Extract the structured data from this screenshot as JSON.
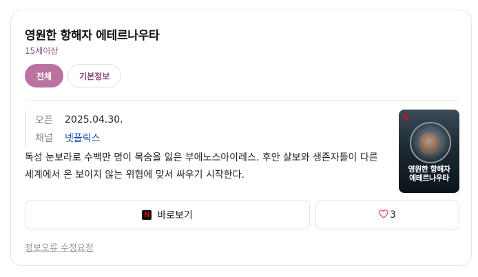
{
  "title": "영원한 항해자 에테르나우타",
  "rating": "15세이상",
  "tabs": [
    {
      "label": "전체",
      "active": true
    },
    {
      "label": "기본정보",
      "active": false
    }
  ],
  "info": {
    "open_label": "오픈",
    "open_value": "2025.04.30.",
    "channel_label": "채널",
    "channel_value": "넷플릭스"
  },
  "description": "독성 눈보라로 수백만 명이 목숨을 잃은 부에노스아이레스. 후안 살보와 생존자들이 다른 세계에서 온 보이지 않는 위협에 맞서 싸우기 시작한다.",
  "poster": {
    "brand_letter": "N",
    "title_line1": "영원한 항해자",
    "title_line2": "에테르나우타"
  },
  "buttons": {
    "watch_icon": "N",
    "watch_label": "바로보기",
    "like_icon": "heart-icon",
    "like_count": "3"
  },
  "report_label": "정보오류 수정요청",
  "colors": {
    "accent": "#b9739f",
    "rating_text": "#8a4a78",
    "link": "#1a4fb5",
    "netflix_red": "#e50914"
  }
}
